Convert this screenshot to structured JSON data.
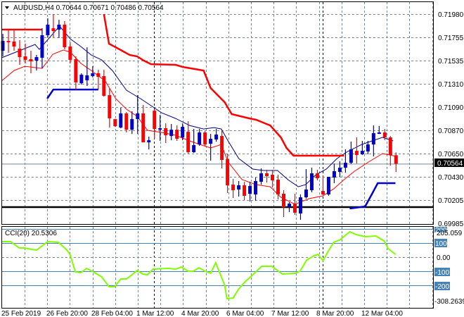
{
  "header": {
    "symbol": "AUDUSD,H4",
    "open": "0.70644",
    "high": "0.70671",
    "low": "0.70486",
    "close": "0.70564"
  },
  "indicator": {
    "label": "CCI(20) 20.5306",
    "max_label": "205.059",
    "min_label": "-308.2639",
    "levels": [
      "200",
      "100",
      "0.00",
      "-100",
      "-200"
    ]
  },
  "price_axis": [
    "0.71980",
    "0.71755",
    "0.71535",
    "0.71310",
    "0.71090",
    "0.70870",
    "0.70650",
    "0.70430",
    "0.70205",
    "0.69985"
  ],
  "current_price": "0.70564",
  "time_axis": [
    "25 Feb 2019",
    "26 Feb 20:00",
    "28 Feb 04:00",
    "1 Mar 12:00",
    "4 Mar 20:00",
    "6 Mar 04:00",
    "7 Mar 12:00",
    "8 Mar 20:00",
    "12 Mar 04:00"
  ],
  "colors": {
    "bull": "#0000cc",
    "bear": "#ff0000",
    "ma_fast": "#000080",
    "ma_slow": "#ff0000",
    "cci": "#7fff00",
    "level": "#4682b4",
    "grid": "#778899"
  },
  "chart_data": {
    "type": "candlestick",
    "symbol": "AUDUSD",
    "timeframe": "H4",
    "ylim": [
      0.69985,
      0.7198
    ],
    "support_line": 0.70153,
    "candles_ohlc": [
      [
        0.71633,
        0.71793,
        0.7158,
        0.71726
      ],
      [
        0.71726,
        0.71833,
        0.71613,
        0.71713
      ],
      [
        0.7172,
        0.71833,
        0.71633,
        0.71673
      ],
      [
        0.71653,
        0.71733,
        0.715,
        0.71573
      ],
      [
        0.7158,
        0.717,
        0.71513,
        0.71546
      ],
      [
        0.71553,
        0.71633,
        0.7142,
        0.71533
      ],
      [
        0.7154,
        0.71593,
        0.71446,
        0.71573
      ],
      [
        0.71566,
        0.71846,
        0.71466,
        0.7178
      ],
      [
        0.7178,
        0.7194,
        0.7176,
        0.7188
      ],
      [
        0.71846,
        0.7198,
        0.7176,
        0.7182
      ],
      [
        0.71833,
        0.71926,
        0.71753,
        0.7188
      ],
      [
        0.7188,
        0.71913,
        0.71646,
        0.71666
      ],
      [
        0.71673,
        0.71713,
        0.71513,
        0.71546
      ],
      [
        0.71553,
        0.7158,
        0.71266,
        0.71333
      ],
      [
        0.71326,
        0.7142,
        0.71313,
        0.71406
      ],
      [
        0.71353,
        0.71666,
        0.713,
        0.714
      ],
      [
        0.71393,
        0.71486,
        0.7138,
        0.7142
      ],
      [
        0.7142,
        0.71453,
        0.71266,
        0.71386
      ],
      [
        0.71393,
        0.71453,
        0.712,
        0.71206
      ],
      [
        0.71213,
        0.7128,
        0.70906,
        0.70993
      ],
      [
        0.70986,
        0.70986,
        0.70913,
        0.7092
      ],
      [
        0.70906,
        0.71093,
        0.709,
        0.7104
      ],
      [
        0.7104,
        0.71053,
        0.7086,
        0.70886
      ],
      [
        0.70886,
        0.7106,
        0.70846,
        0.70986
      ],
      [
        0.70986,
        0.71213,
        0.70846,
        0.7104
      ],
      [
        0.7104,
        0.7112,
        0.70766,
        0.70766
      ],
      [
        0.70766,
        0.7082,
        0.707,
        0.70786
      ],
      [
        0.71066,
        0.7108,
        0.708,
        0.70893
      ],
      [
        0.70886,
        0.71026,
        0.7078,
        0.709
      ],
      [
        0.709,
        0.70946,
        0.7076,
        0.70833
      ],
      [
        0.70826,
        0.7094,
        0.70786,
        0.70886
      ],
      [
        0.70886,
        0.70926,
        0.7078,
        0.708
      ],
      [
        0.70813,
        0.70946,
        0.70786,
        0.70913
      ],
      [
        0.70866,
        0.70966,
        0.7066,
        0.70673
      ],
      [
        0.70673,
        0.70893,
        0.70666,
        0.7074
      ],
      [
        0.70746,
        0.70893,
        0.70733,
        0.7086
      ],
      [
        0.7086,
        0.70873,
        0.70726,
        0.70746
      ],
      [
        0.70753,
        0.70846,
        0.70593,
        0.708
      ],
      [
        0.70793,
        0.70893,
        0.70773,
        0.7084
      ],
      [
        0.70826,
        0.7088,
        0.7052,
        0.706
      ],
      [
        0.70606,
        0.7066,
        0.70286,
        0.7036
      ],
      [
        0.70366,
        0.7042,
        0.7024,
        0.70313
      ],
      [
        0.7032,
        0.704,
        0.70253,
        0.7036
      ],
      [
        0.7036,
        0.70393,
        0.7022,
        0.7026
      ],
      [
        0.7028,
        0.70393,
        0.70206,
        0.70353
      ],
      [
        0.70273,
        0.70433,
        0.70213,
        0.704
      ],
      [
        0.70393,
        0.7052,
        0.70366,
        0.70473
      ],
      [
        0.70473,
        0.70506,
        0.70386,
        0.70446
      ],
      [
        0.7046,
        0.70506,
        0.7034,
        0.70406
      ],
      [
        0.70413,
        0.7046,
        0.70226,
        0.70273
      ],
      [
        0.7028,
        0.70313,
        0.7006,
        0.70153
      ],
      [
        0.70153,
        0.702,
        0.70106,
        0.70186
      ],
      [
        0.70186,
        0.7028,
        0.7008,
        0.701
      ],
      [
        0.70093,
        0.70273,
        0.70033,
        0.70246
      ],
      [
        0.70246,
        0.70513,
        0.70233,
        0.7032
      ],
      [
        0.70313,
        0.70526,
        0.70293,
        0.70473
      ],
      [
        0.70473,
        0.70506,
        0.70406,
        0.70426
      ],
      [
        0.70306,
        0.70453,
        0.70266,
        0.70273
      ],
      [
        0.70273,
        0.7044,
        0.7026,
        0.7044
      ],
      [
        0.70433,
        0.70566,
        0.7038,
        0.70493
      ],
      [
        0.70486,
        0.70586,
        0.7044,
        0.70526
      ],
      [
        0.70526,
        0.707,
        0.7048,
        0.70573
      ],
      [
        0.70573,
        0.70773,
        0.7056,
        0.707
      ],
      [
        0.70686,
        0.70813,
        0.70566,
        0.70646
      ],
      [
        0.70653,
        0.7078,
        0.70646,
        0.70686
      ],
      [
        0.7068,
        0.7078,
        0.70653,
        0.70746
      ],
      [
        0.70746,
        0.70926,
        0.70633,
        0.70853
      ],
      [
        0.70846,
        0.7092,
        0.70846,
        0.7086
      ],
      [
        0.7086,
        0.70893,
        0.70786,
        0.70813
      ],
      [
        0.70813,
        0.70826,
        0.70546,
        0.70646
      ],
      [
        0.70644,
        0.70671,
        0.70486,
        0.70564
      ]
    ],
    "ma_fast": [
      [
        -0.25,
        0.71566
      ],
      [
        5.75,
        0.71693
      ],
      [
        6.5,
        0.71646
      ],
      [
        10.1,
        0.71866
      ],
      [
        12,
        0.71746
      ],
      [
        13.9,
        0.71673
      ],
      [
        15.75,
        0.71593
      ],
      [
        17.6,
        0.71546
      ],
      [
        19.5,
        0.71446
      ],
      [
        22,
        0.7126
      ],
      [
        24.5,
        0.7118
      ],
      [
        26.4,
        0.71113
      ],
      [
        28.25,
        0.71046
      ],
      [
        30.75,
        0.70993
      ],
      [
        33.25,
        0.70926
      ],
      [
        35.75,
        0.70893
      ],
      [
        37.6,
        0.70906
      ],
      [
        38.9,
        0.70893
      ],
      [
        40.1,
        0.7078
      ],
      [
        42,
        0.70613
      ],
      [
        44.5,
        0.70513
      ],
      [
        46.4,
        0.705
      ],
      [
        48.9,
        0.705
      ],
      [
        50.75,
        0.70413
      ],
      [
        52.6,
        0.70346
      ],
      [
        53.9,
        0.70366
      ],
      [
        55.75,
        0.7046
      ],
      [
        57.6,
        0.70513
      ],
      [
        59.5,
        0.70613
      ],
      [
        61.4,
        0.7068
      ],
      [
        63.9,
        0.70746
      ],
      [
        65.75,
        0.7078
      ],
      [
        67.6,
        0.70813
      ],
      [
        69.5,
        0.7078
      ]
    ],
    "ma_slow": [
      [
        -0.25,
        0.71346
      ],
      [
        2,
        0.71446
      ],
      [
        3.9,
        0.71486
      ],
      [
        7,
        0.71466
      ],
      [
        8.9,
        0.716
      ],
      [
        10.75,
        0.7164
      ],
      [
        12,
        0.7162
      ],
      [
        13.9,
        0.71513
      ],
      [
        15.75,
        0.71446
      ],
      [
        18.25,
        0.71346
      ],
      [
        20.1,
        0.7118
      ],
      [
        22,
        0.7108
      ],
      [
        23.9,
        0.71013
      ],
      [
        25.75,
        0.7088
      ],
      [
        28.25,
        0.7086
      ],
      [
        30.75,
        0.70833
      ],
      [
        33.25,
        0.7078
      ],
      [
        35.1,
        0.70746
      ],
      [
        37,
        0.70713
      ],
      [
        38.9,
        0.70746
      ],
      [
        40.1,
        0.7058
      ],
      [
        42.6,
        0.70413
      ],
      [
        45.1,
        0.70366
      ],
      [
        47.6,
        0.70346
      ],
      [
        49.5,
        0.70246
      ],
      [
        52,
        0.7018
      ],
      [
        54.5,
        0.70233
      ],
      [
        57,
        0.7026
      ],
      [
        58.9,
        0.70326
      ],
      [
        60.75,
        0.70413
      ],
      [
        62.6,
        0.70493
      ],
      [
        65.1,
        0.7058
      ],
      [
        67.6,
        0.7066
      ],
      [
        70.1,
        0.70633
      ]
    ],
    "resistance_steps": [
      [
        [
          -0.25,
          0.71833
        ],
        [
          7,
          0.71833
        ]
      ],
      [
        [
          18,
          0.7198
        ],
        [
          18.9,
          0.717
        ],
        [
          20.1,
          0.71666
        ],
        [
          22.6,
          0.71593
        ],
        [
          23.9,
          0.7158
        ],
        [
          25.1,
          0.7154
        ],
        [
          26.4,
          0.71506
        ],
        [
          30.75,
          0.715
        ],
        [
          32,
          0.7148
        ],
        [
          35.75,
          0.71446
        ],
        [
          37,
          0.7128
        ],
        [
          39.5,
          0.71146
        ],
        [
          40.75,
          0.71033
        ],
        [
          43.9,
          0.70993
        ],
        [
          45.1,
          0.7098
        ],
        [
          47.6,
          0.70926
        ],
        [
          49.5,
          0.70813
        ],
        [
          50.5,
          0.70713
        ],
        [
          51.75,
          0.7064
        ],
        [
          60.75,
          0.7064
        ]
      ]
    ],
    "support_steps": [
      [
        [
          7.9,
          0.7118
        ],
        [
          9,
          0.71266
        ],
        [
          17,
          0.71266
        ]
      ],
      [
        [
          61.75,
          0.7014
        ],
        [
          62.6,
          0.70146
        ],
        [
          64.5,
          0.7016
        ],
        [
          65.75,
          0.7028
        ],
        [
          66.75,
          0.7038
        ],
        [
          69.9,
          0.7038
        ]
      ]
    ],
    "cci": {
      "period": 20,
      "ylim": [
        -308.2639,
        205.059
      ],
      "levels": [
        200,
        100,
        0,
        -100,
        -200
      ],
      "values": [
        [
          -0.25,
          110
        ],
        [
          1.4,
          110
        ],
        [
          2.9,
          65
        ],
        [
          3.9,
          65
        ],
        [
          5.1,
          55
        ],
        [
          6,
          50
        ],
        [
          7,
          80
        ],
        [
          8,
          110
        ],
        [
          9.9,
          105
        ],
        [
          11.4,
          50
        ],
        [
          12,
          15
        ],
        [
          12.9,
          -105
        ],
        [
          13.9,
          -110
        ],
        [
          14.9,
          -80
        ],
        [
          16.1,
          -105
        ],
        [
          17.6,
          -140
        ],
        [
          18.9,
          -210
        ],
        [
          19.9,
          -210
        ],
        [
          21,
          -155
        ],
        [
          22,
          -155
        ],
        [
          23,
          -125
        ],
        [
          23.9,
          -95
        ],
        [
          24.9,
          -120
        ],
        [
          25.75,
          -125
        ],
        [
          26.75,
          -85
        ],
        [
          29.5,
          -80
        ],
        [
          30.75,
          -85
        ],
        [
          31.75,
          -70
        ],
        [
          33,
          -100
        ],
        [
          33.9,
          -100
        ],
        [
          34.9,
          -75
        ],
        [
          36,
          -100
        ],
        [
          37,
          -115
        ],
        [
          37.9,
          -40
        ],
        [
          38.5,
          -100
        ],
        [
          39.5,
          -200
        ],
        [
          39.9,
          -295
        ],
        [
          41,
          -290
        ],
        [
          42,
          -225
        ],
        [
          43.25,
          -170
        ],
        [
          44.5,
          -125
        ],
        [
          46.1,
          -65
        ],
        [
          47.9,
          -65
        ],
        [
          49.75,
          -120
        ],
        [
          52,
          -115
        ],
        [
          52.9,
          -100
        ],
        [
          54.1,
          -20
        ],
        [
          55.4,
          10
        ],
        [
          56.1,
          20
        ],
        [
          57,
          -25
        ],
        [
          57.9,
          40
        ],
        [
          58.9,
          105
        ],
        [
          60.1,
          125
        ],
        [
          61.75,
          180
        ],
        [
          62.9,
          160
        ],
        [
          64.5,
          145
        ],
        [
          66.4,
          150
        ],
        [
          67.9,
          115
        ],
        [
          68.6,
          60
        ],
        [
          69.9,
          20
        ]
      ]
    }
  }
}
